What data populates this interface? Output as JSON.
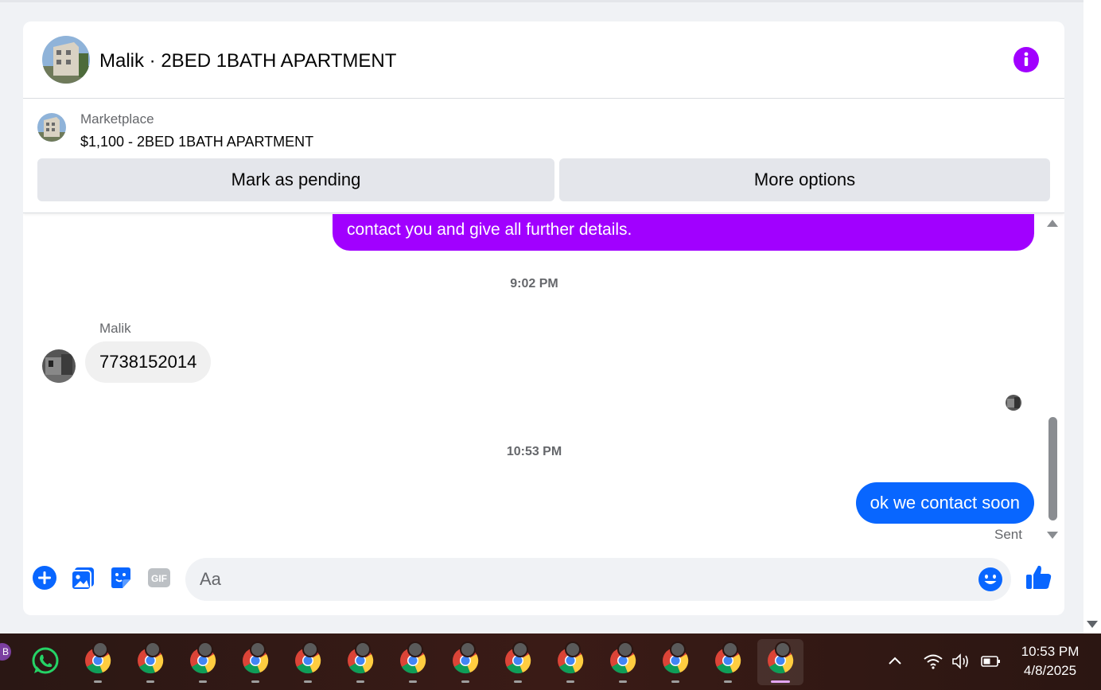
{
  "header": {
    "title": "Malik · 2BED 1BATH APARTMENT"
  },
  "listing": {
    "source": "Marketplace",
    "price_title": "$1,100 - 2BED 1BATH APARTMENT",
    "mark_pending_label": "Mark as pending",
    "more_options_label": "More options"
  },
  "messages": {
    "outgoing_partial": "contact you and give all further details.",
    "timestamp_1": "9:02 PM",
    "sender_name": "Malik",
    "incoming_text": "7738152014",
    "timestamp_2": "10:53 PM",
    "outgoing_text": "ok we contact soon",
    "status": "Sent"
  },
  "composer": {
    "placeholder": "Aa",
    "gif_label": "GIF"
  },
  "taskbar": {
    "time": "10:53 PM",
    "date": "4/8/2025",
    "corner_badge": "B"
  },
  "colors": {
    "accent_purple": "#a100ff",
    "messenger_blue": "#0866ff"
  }
}
